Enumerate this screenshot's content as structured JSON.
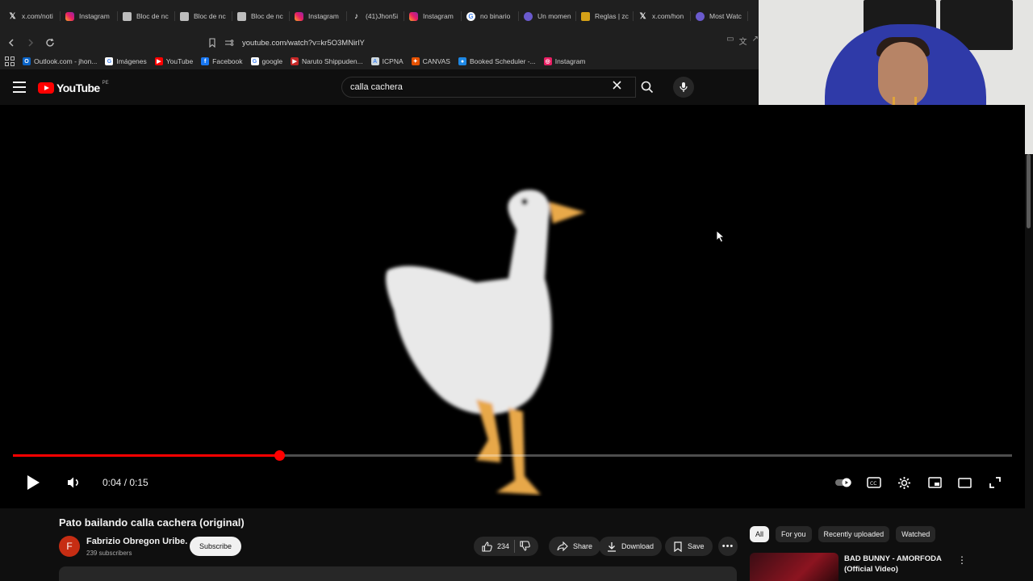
{
  "browser": {
    "tabs": [
      {
        "icon": "x-icon",
        "label": "x.com/noti"
      },
      {
        "icon": "instagram-icon",
        "label": "Instagram"
      },
      {
        "icon": "doc-icon",
        "label": "Bloc de nc"
      },
      {
        "icon": "doc-icon",
        "label": "Bloc de nc"
      },
      {
        "icon": "doc-icon",
        "label": "Bloc de nc"
      },
      {
        "icon": "instagram-icon",
        "label": "Instagram"
      },
      {
        "icon": "tiktok-icon",
        "label": "(41)Jhon5i"
      },
      {
        "icon": "instagram-icon",
        "label": "Instagram"
      },
      {
        "icon": "google-icon",
        "label": "no binario"
      },
      {
        "icon": "zoom-icon",
        "label": "Un momen"
      },
      {
        "icon": "rules-icon",
        "label": "Reglas | zc"
      },
      {
        "icon": "x-icon",
        "label": "x.com/hon"
      },
      {
        "icon": "zoom-icon",
        "label": "Most Watc"
      }
    ],
    "url": "youtube.com/watch?v=kr5O3MNirlY",
    "bookmarks": [
      {
        "label": "Outlook.com - jhon...",
        "color": "#0a64c8",
        "glyph": "O"
      },
      {
        "label": "Imágenes",
        "color": "#ffffff",
        "glyph": "G"
      },
      {
        "label": "YouTube",
        "color": "#ff0000",
        "glyph": "▶"
      },
      {
        "label": "Facebook",
        "color": "#1877f2",
        "glyph": "f"
      },
      {
        "label": "google",
        "color": "#ffffff",
        "glyph": "G"
      },
      {
        "label": "Naruto Shippuden...",
        "color": "#c62828",
        "glyph": "▶"
      },
      {
        "label": "ICPNA",
        "color": "#cfd8dc",
        "glyph": "A"
      },
      {
        "label": "CANVAS",
        "color": "#e65100",
        "glyph": "✦"
      },
      {
        "label": "Booked Scheduler -...",
        "color": "#1e88e5",
        "glyph": "●"
      },
      {
        "label": "Instagram",
        "color": "#e91e63",
        "glyph": "◎"
      }
    ]
  },
  "youtube": {
    "logo_text": "YouTube",
    "country": "PE",
    "search_value": "calla cachera"
  },
  "player": {
    "current_time": "0:04",
    "duration": "0:15",
    "time_display": "0:04 / 0:15",
    "progress_fraction": 0.2667
  },
  "video": {
    "title": "Pato bailando calla cachera (original)",
    "channel_initial": "F",
    "channel_name": "Fabrizio Obregon Uribe.",
    "subscribers": "239 subscribers",
    "subscribe_label": "Subscribe",
    "likes": "234",
    "share_label": "Share",
    "download_label": "Download",
    "save_label": "Save"
  },
  "recommendations": {
    "chips": [
      "All",
      "For you",
      "Recently uploaded",
      "Watched"
    ],
    "first_title": "BAD BUNNY - AMORFODA (Official Video)"
  }
}
